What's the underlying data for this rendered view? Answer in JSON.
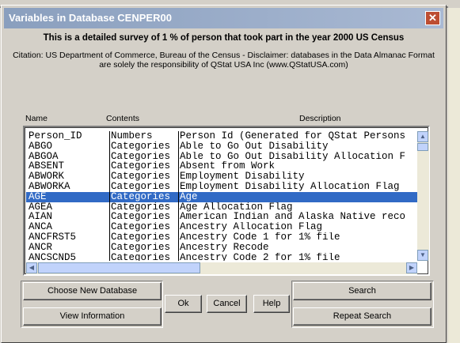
{
  "window": {
    "title": "Variables in Database CENPER00",
    "close_glyph": "✕"
  },
  "heading": "This is a detailed survey of 1 % of person that took part in the year 2000 US Census",
  "citation": {
    "line1": "Citation: US Department of Commerce, Bureau of the Census - Disclaimer: databases in the Data Almanac Format",
    "line2": "are solely the responsibility of QStat USA Inc (www.QStatUSA.com)"
  },
  "columns": {
    "name": "Name",
    "contents": "Contents",
    "description": "Description"
  },
  "rows": [
    {
      "name": "Person_ID",
      "contents": "Numbers",
      "description": "Person Id (Generated for QStat Persons"
    },
    {
      "name": "ABGO",
      "contents": "Categories",
      "description": "Able to Go Out Disability"
    },
    {
      "name": "ABGOA",
      "contents": "Categories",
      "description": "Able to Go Out Disability Allocation F"
    },
    {
      "name": "ABSENT",
      "contents": "Categories",
      "description": "Absent from Work"
    },
    {
      "name": "ABWORK",
      "contents": "Categories",
      "description": "Employment Disability"
    },
    {
      "name": "ABWORKA",
      "contents": "Categories",
      "description": "Employment Disability Allocation Flag"
    },
    {
      "name": "AGE",
      "contents": "Categories",
      "description": "Age",
      "selected": true
    },
    {
      "name": "AGEA",
      "contents": "Categories",
      "description": "Age Allocation Flag"
    },
    {
      "name": "AIAN",
      "contents": "Categories",
      "description": "American Indian and Alaska Native reco"
    },
    {
      "name": "ANCA",
      "contents": "Categories",
      "description": "Ancestry Allocation Flag"
    },
    {
      "name": "ANCFRST5",
      "contents": "Categories",
      "description": "Ancestry Code 1 for 1% file"
    },
    {
      "name": "ANCR",
      "contents": "Categories",
      "description": "Ancestry Recode"
    },
    {
      "name": "ANCSCND5",
      "contents": "Categories",
      "description": "Ancestry Code 2 for 1% file"
    }
  ],
  "buttons": {
    "choose_new_database": "Choose New Database",
    "view_information": "View Information",
    "ok": "Ok",
    "cancel": "Cancel",
    "help": "Help",
    "search": "Search",
    "repeat_search": "Repeat Search"
  },
  "icons": {
    "scroll_up": "▲",
    "scroll_down": "▼",
    "scroll_left": "◀",
    "scroll_right": "▶"
  },
  "colors": {
    "selection": "#316ac5",
    "titlebar": "#8a9fbe",
    "close_button": "#bd4d32",
    "dialog_face": "#d4d0c8"
  }
}
